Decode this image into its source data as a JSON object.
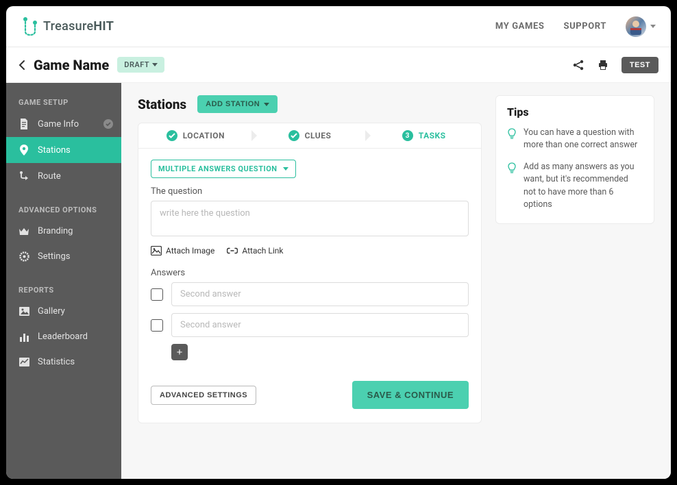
{
  "brand": {
    "prefix": "Treasure",
    "suffix": "HIT"
  },
  "nav": {
    "mygames": "MY GAMES",
    "support": "SUPPORT"
  },
  "header": {
    "gameTitle": "Game Name",
    "statusBadge": "DRAFT",
    "testBtn": "TEST"
  },
  "sidebar": {
    "sections": [
      {
        "header": "GAME SETUP",
        "items": [
          {
            "label": "Game Info",
            "checked": true
          },
          {
            "label": "Stations",
            "active": true
          },
          {
            "label": "Route"
          }
        ]
      },
      {
        "header": "ADVANCED OPTIONS",
        "items": [
          {
            "label": "Branding"
          },
          {
            "label": "Settings"
          }
        ]
      },
      {
        "header": "REPORTS",
        "items": [
          {
            "label": "Gallery"
          },
          {
            "label": "Leaderboard"
          },
          {
            "label": "Statistics"
          }
        ]
      }
    ]
  },
  "page": {
    "title": "Stations",
    "addStationBtn": "ADD STATION"
  },
  "stepper": {
    "steps": [
      {
        "label": "LOCATION",
        "state": "done"
      },
      {
        "label": "CLUES",
        "state": "done"
      },
      {
        "label": "TASKS",
        "state": "current",
        "num": "3"
      }
    ]
  },
  "form": {
    "questionType": "MULTIPLE ANSWERS QUESTION",
    "questionLabel": "The question",
    "questionPlaceholder": "write here the question",
    "attachImage": "Attach Image",
    "attachLink": "Attach Link",
    "answersLabel": "Answers",
    "answers": [
      {
        "placeholder": "Second answer"
      },
      {
        "placeholder": "Second answer"
      }
    ],
    "addAnswerSymbol": "+",
    "advancedSettings": "ADVANCED SETTINGS",
    "saveBtn": "SAVE & CONTINUE"
  },
  "tips": {
    "title": "Tips",
    "items": [
      "You can have a question with more than one correct answer",
      "Add as many answers as you want, but it's recommended not to have more than 6 options"
    ]
  }
}
